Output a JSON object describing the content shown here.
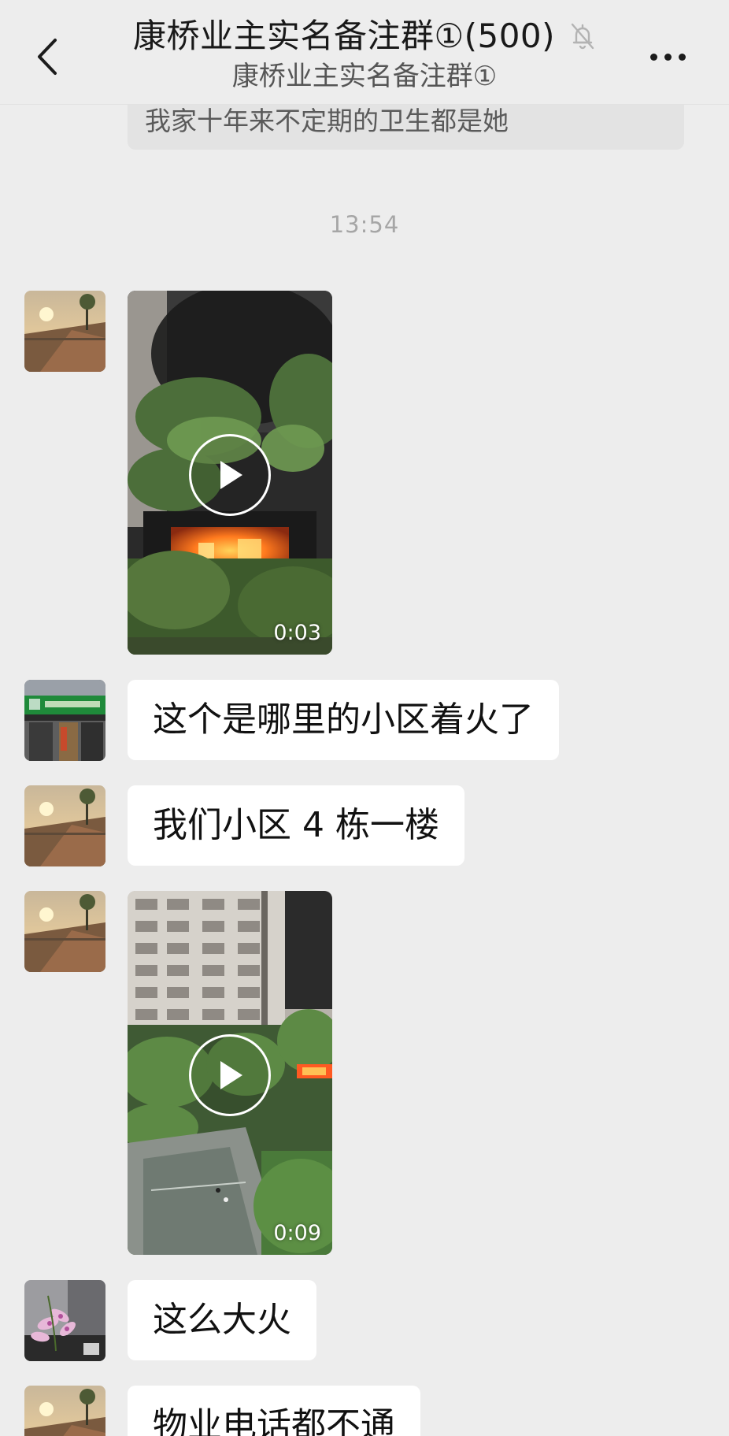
{
  "header": {
    "title": "康桥业主实名备注群①(500)",
    "subtitle": "康桥业主实名备注群①",
    "muted": true
  },
  "top_message": {
    "text": "我家十年来不定期的卫生都是她"
  },
  "timestamp": "13:54",
  "messages": [
    {
      "type": "video",
      "avatar": "sunset-riverside",
      "duration": "0:03"
    },
    {
      "type": "text",
      "avatar": "storefront",
      "text": "这个是哪里的小区着火了"
    },
    {
      "type": "text",
      "avatar": "sunset-riverside",
      "text": "我们小区 4 栋一楼"
    },
    {
      "type": "video",
      "avatar": "sunset-riverside",
      "duration": "0:09"
    },
    {
      "type": "text",
      "avatar": "orchid-flowers",
      "text": "这么大火"
    },
    {
      "type": "text",
      "avatar": "sunset-riverside",
      "text": "物业电话都不通"
    }
  ],
  "colors": {
    "background": "#ededed",
    "bubble": "#ffffff",
    "timestamp": "#a6a6a6"
  }
}
